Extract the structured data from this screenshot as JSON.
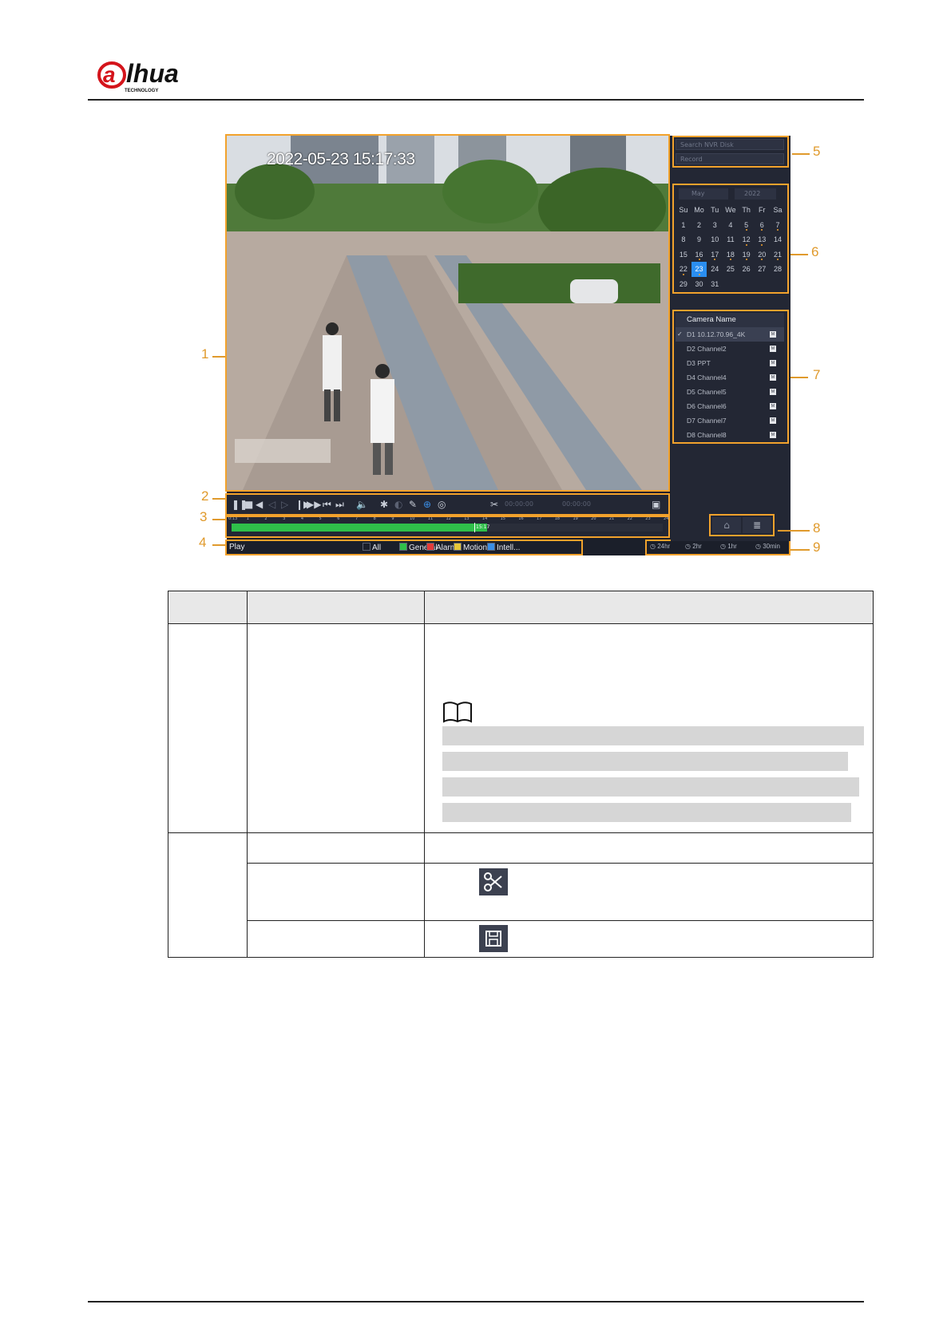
{
  "header": {
    "logo_text": "alhua",
    "logo_sub": "TECHNOLOGY"
  },
  "figure": {
    "osd_timestamp": "2022-05-23 15:17:33",
    "right_panel": {
      "search_dropdown": "Search NVR Disk",
      "type_dropdown": "Record",
      "month_select": "May",
      "year_select": "2022",
      "weekdays": [
        "Su",
        "Mo",
        "Tu",
        "We",
        "Th",
        "Fr",
        "Sa"
      ],
      "days": [
        "1",
        "2",
        "3",
        "4",
        "5",
        "6",
        "7",
        "8",
        "9",
        "10",
        "11",
        "12",
        "13",
        "14",
        "15",
        "16",
        "17",
        "18",
        "19",
        "20",
        "21",
        "22",
        "23",
        "24",
        "25",
        "26",
        "27",
        "28",
        "29",
        "30",
        "31"
      ],
      "days_with_records": [
        "5",
        "6",
        "7",
        "12",
        "13",
        "16",
        "17",
        "18",
        "19",
        "20",
        "21",
        "22",
        "23"
      ],
      "selected_day": "23",
      "camera_list_header": "Camera Name",
      "cameras": [
        {
          "label": "D1 10.12.70.96_4K",
          "checked": true
        },
        {
          "label": "D2 Channel2",
          "checked": false
        },
        {
          "label": "D3 PPT",
          "checked": false
        },
        {
          "label": "D4 Channel4",
          "checked": false
        },
        {
          "label": "D5 Channel5",
          "checked": false
        },
        {
          "label": "D6 Channel6",
          "checked": false
        },
        {
          "label": "D7 Channel7",
          "checked": false
        },
        {
          "label": "D8 Channel8",
          "checked": false
        }
      ],
      "camera_badge": "M"
    },
    "control_bar": {
      "clip_start": "00:00:00",
      "clip_end": "00:00:00"
    },
    "timeline": {
      "ticks": [
        "0:13",
        "1",
        "2",
        "3",
        "4",
        "5",
        "6",
        "7",
        "8",
        "9",
        "10",
        "11",
        "12",
        "13",
        "14",
        "15",
        "16",
        "17",
        "18",
        "19",
        "20",
        "21",
        "22",
        "23",
        "24"
      ],
      "cursor_label": "15:17"
    },
    "bottom_bar": {
      "mode": "Play",
      "filters": [
        {
          "label": "All",
          "color": "#1b1f2a"
        },
        {
          "label": "General",
          "color": "#2fbf4a"
        },
        {
          "label": "Alarm",
          "color": "#e23b3b"
        },
        {
          "label": "Motion",
          "color": "#e6c63a"
        },
        {
          "label": "Intell...",
          "color": "#3a8ee6"
        }
      ],
      "scales": [
        "24hr",
        "2hr",
        "1hr",
        "30min"
      ]
    },
    "callouts": [
      "1",
      "2",
      "3",
      "4",
      "5",
      "6",
      "7",
      "8",
      "9"
    ]
  },
  "table": {
    "icon_names": [
      "scissors-icon",
      "save-icon"
    ]
  }
}
